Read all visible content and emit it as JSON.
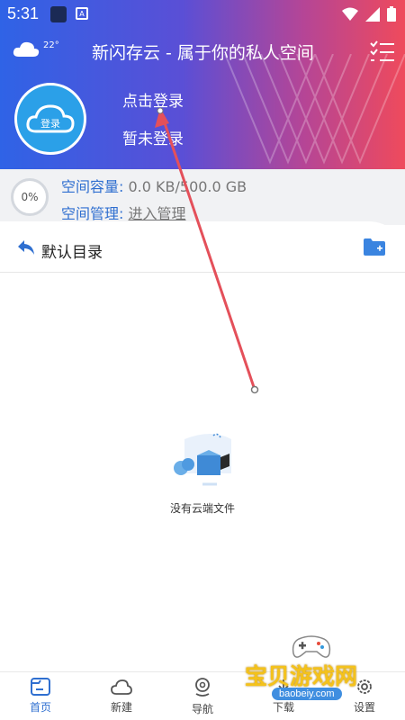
{
  "status_bar": {
    "time": "5:31",
    "icon_letter": "A"
  },
  "header": {
    "weather_temp": "22°",
    "title": "新闪存云 - 属于你的私人空间",
    "avatar_label": "登录",
    "login_link": "点击登录",
    "login_status": "暂未登录"
  },
  "storage": {
    "percent": "0%",
    "capacity_label": "空间容量:",
    "capacity_value": "0.0 KB/500.0 GB",
    "manage_label": "空间管理:",
    "manage_link": "进入管理"
  },
  "directory": {
    "title": "默认目录"
  },
  "empty_state": {
    "message": "没有云端文件"
  },
  "nav": [
    {
      "label": "首页",
      "icon": "home-icon",
      "active": true
    },
    {
      "label": "新建",
      "icon": "cloud-icon",
      "active": false
    },
    {
      "label": "导航",
      "icon": "location-pin-icon",
      "active": false
    },
    {
      "label": "下载",
      "icon": "download-icon",
      "active": false
    },
    {
      "label": "设置",
      "icon": "gear-icon",
      "active": false
    }
  ],
  "watermark": {
    "text": "宝贝游戏网",
    "url": "baobeiy.com"
  },
  "colors": {
    "accent": "#2f6fd0",
    "gradient_start": "#2f63e6",
    "gradient_end": "#ef4a5c",
    "annotation": "#e4505a"
  }
}
